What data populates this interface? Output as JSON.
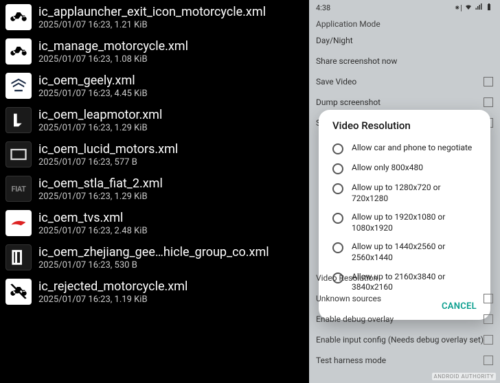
{
  "files": [
    {
      "name": "ic_applauncher_exit_icon_motorcycle.xml",
      "meta": "2025/01/07 16:23, 1.21 KiB",
      "iconType": "motorcycle",
      "bg": "bg-white"
    },
    {
      "name": "ic_manage_motorcycle.xml",
      "meta": "2025/01/07 16:23, 1.08 KiB",
      "iconType": "motorcycle",
      "bg": "bg-white"
    },
    {
      "name": "ic_oem_geely.xml",
      "meta": "2025/01/07 16:23, 4.45 KiB",
      "iconType": "geely",
      "bg": "bg-white"
    },
    {
      "name": "ic_oem_leapmotor.xml",
      "meta": "2025/01/07 16:23, 1.29 KiB",
      "iconType": "leapmotor",
      "bg": "bg-dark"
    },
    {
      "name": "ic_oem_lucid_motors.xml",
      "meta": "2025/01/07 16:23, 577 B",
      "iconType": "lucid",
      "bg": "bg-dark"
    },
    {
      "name": "ic_oem_stla_fiat_2.xml",
      "meta": "2025/01/07 16:23, 1.29 KiB",
      "iconType": "fiat",
      "bg": "bg-dark"
    },
    {
      "name": "ic_oem_tvs.xml",
      "meta": "2025/01/07 16:23, 2.48 KiB",
      "iconType": "tvs",
      "bg": "bg-white"
    },
    {
      "name": "ic_oem_zhejiang_gee…hicle_group_co.xml",
      "meta": "2025/01/07 16:23, 530 B",
      "iconType": "zhejiang",
      "bg": "bg-dark"
    },
    {
      "name": "ic_rejected_motorcycle.xml",
      "meta": "2025/01/07 16:23, 1.19 KiB",
      "iconType": "motorcycle-x",
      "bg": "bg-white"
    }
  ],
  "phone": {
    "status_time": "4:38",
    "section_header": "Application Mode",
    "settings_top": [
      {
        "label": "Day/Night",
        "checkbox": false
      },
      {
        "label": "Share screenshot now",
        "checkbox": false
      },
      {
        "label": "Save Video",
        "checkbox": true
      },
      {
        "label": "Dump screenshot",
        "checkbox": true
      },
      {
        "label": "Save Audio",
        "checkbox": true
      }
    ],
    "settings_bottom": [
      {
        "label": "Video Resolution",
        "checkbox": false
      },
      {
        "label": "Unknown sources",
        "checkbox": true
      },
      {
        "label": "Enable debug overlay",
        "checkbox": true
      },
      {
        "label": "Enable input config (Needs debug overlay set)",
        "checkbox": true
      },
      {
        "label": "Test harness mode",
        "checkbox": true
      }
    ],
    "dialog": {
      "title": "Video Resolution",
      "options": [
        "Allow car and phone to negotiate",
        "Allow only 800x480",
        "Allow up to 1280x720 or 720x1280",
        "Allow up to 1920x1080 or 1080x1920",
        "Allow up to 1440x2560 or 2560x1440",
        "Allow up to 2160x3840 or 3840x2160"
      ],
      "cancel": "CANCEL"
    },
    "watermark": "ANDROID AUTHORITY"
  }
}
